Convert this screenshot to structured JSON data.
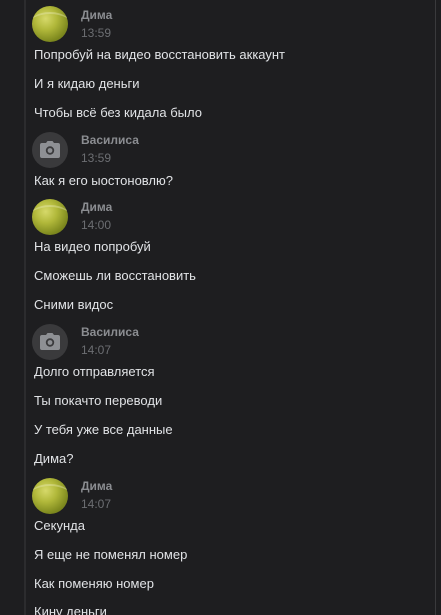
{
  "groups": [
    {
      "author": "Дима",
      "time": "13:59",
      "avatar": "tennis-ball-avatar",
      "messages": [
        "Попробуй на видео восстановить аккаунт",
        "И я кидаю деньги",
        "Чтобы всё без кидала было"
      ]
    },
    {
      "author": "Василиса",
      "time": "13:59",
      "avatar": "camera-icon",
      "messages": [
        "Как я его ыостоновлю?"
      ]
    },
    {
      "author": "Дима",
      "time": "14:00",
      "avatar": "tennis-ball-avatar",
      "messages": [
        "На видео попробуй",
        "Сможешь ли восстановить",
        "Сними видос"
      ]
    },
    {
      "author": "Василиса",
      "time": "14:07",
      "avatar": "camera-icon",
      "messages": [
        "Долго отправляется",
        "Ты покачто переводи",
        "У тебя уже все данные",
        "Дима?"
      ]
    },
    {
      "author": "Дима",
      "time": "14:07",
      "avatar": "tennis-ball-avatar",
      "messages": [
        "Секунда",
        "Я еще не поменял номер",
        "Как поменяю номер",
        "Кину деньги"
      ]
    }
  ]
}
